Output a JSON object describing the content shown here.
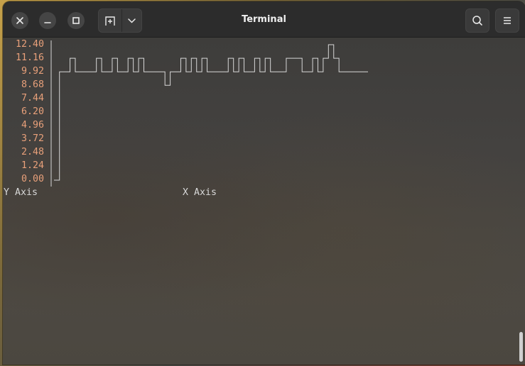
{
  "window": {
    "title": "Terminal",
    "close_icon": "close-icon",
    "minimize_icon": "minimize-icon",
    "maximize_icon": "maximize-icon",
    "new_tab_icon": "new-tab-icon",
    "dropdown_icon": "chevron-down-icon",
    "search_icon": "search-icon",
    "menu_icon": "hamburger-menu-icon"
  },
  "terminal": {
    "x_axis_label": "X Axis",
    "y_axis_label": "Y Axis"
  },
  "chart_data": {
    "type": "line",
    "title": "",
    "xlabel": "X Axis",
    "ylabel": "Y Axis",
    "yticks": [
      "12.40",
      "11.16",
      "9.92",
      "8.68",
      "7.44",
      "6.20",
      "4.96",
      "3.72",
      "2.48",
      "1.24",
      "0.00"
    ],
    "ylim": [
      0,
      12.4
    ],
    "xlim": [
      0,
      60
    ],
    "grid": false,
    "series": [
      {
        "color": "#d7d7d7",
        "values": [
          0,
          9.92,
          9.92,
          11.16,
          9.92,
          9.92,
          9.92,
          9.92,
          11.16,
          9.92,
          9.92,
          11.16,
          9.92,
          9.92,
          11.16,
          9.92,
          11.16,
          9.92,
          9.92,
          9.92,
          9.92,
          8.68,
          9.92,
          9.92,
          11.16,
          9.92,
          11.16,
          9.92,
          11.16,
          9.92,
          9.92,
          9.92,
          9.92,
          11.16,
          9.92,
          11.16,
          9.92,
          9.92,
          11.16,
          9.92,
          11.16,
          9.92,
          9.92,
          9.92,
          11.16,
          11.16,
          11.16,
          9.92,
          9.92,
          11.16,
          9.92,
          11.16,
          12.4,
          11.16,
          9.92,
          9.92,
          9.92,
          9.92,
          9.92,
          9.92
        ]
      }
    ]
  }
}
